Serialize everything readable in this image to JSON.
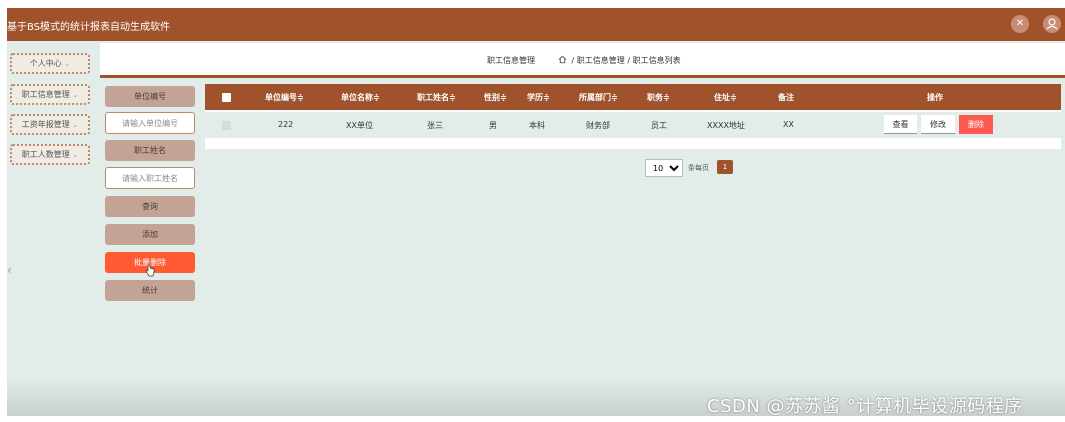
{
  "app": {
    "title": "基于BS模式的统计报表自动生成软件",
    "colors": {
      "brand": "#a0522d",
      "danger": "#ff5a33",
      "background": "#e2ece8"
    }
  },
  "topbar": {
    "icons": [
      "close-icon",
      "user-avatar-icon"
    ]
  },
  "sidebar": {
    "items": [
      {
        "label": "个人中心"
      },
      {
        "label": "职工信息管理"
      },
      {
        "label": "工资年报管理"
      },
      {
        "label": "职工人数管理"
      }
    ]
  },
  "header": {
    "page_name": "职工信息管理",
    "breadcrumb": "/ 职工信息管理 / 职工信息列表"
  },
  "filters": {
    "unit_id_label": "单位编号",
    "unit_id_placeholder": "请输入单位编号",
    "name_label": "职工姓名",
    "name_placeholder": "请输入职工姓名",
    "search_label": "查询",
    "add_label": "添加",
    "batch_delete_label": "批量删除",
    "stats_label": "统计"
  },
  "table": {
    "columns": [
      "单位编号≑",
      "单位名称≑",
      "职工姓名≑",
      "性别≑",
      "学历≑",
      "所属部门≑",
      "职务≑",
      "住址≑",
      "备注",
      "操作"
    ],
    "rows": [
      {
        "unit_id": "222",
        "unit_name": "XX单位",
        "name": "张三",
        "gender": "男",
        "education": "本科",
        "department": "财务部",
        "position": "员工",
        "address": "XXXX地址",
        "remark": "XX"
      }
    ],
    "actions": {
      "view": "查看",
      "edit": "修改",
      "delete": "删除"
    }
  },
  "pagination": {
    "page_size": "10",
    "per_page_label": "条每页",
    "current_page": "1"
  },
  "watermark": "CSDN @苏苏酱    °计算机毕设源码程序"
}
